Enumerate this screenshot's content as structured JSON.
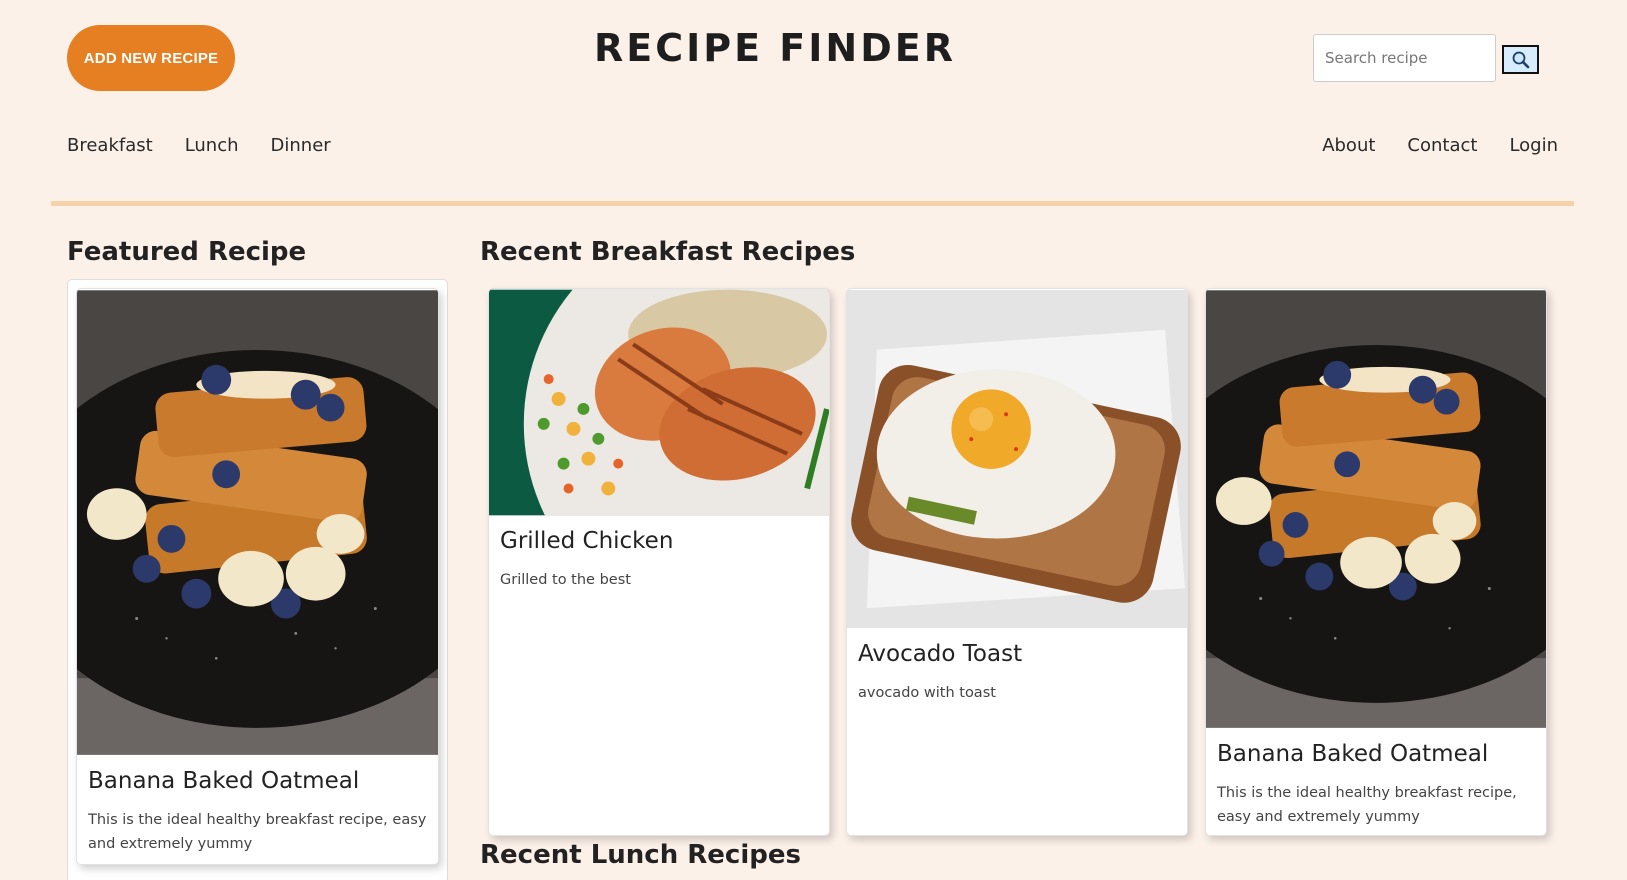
{
  "header": {
    "add_button": "ADD NEW RECIPE",
    "title": "RECIPE FINDER",
    "search_placeholder": "Search recipe",
    "search_icon": "magnifier-icon"
  },
  "nav": {
    "left": [
      "Breakfast",
      "Lunch",
      "Dinner"
    ],
    "right": [
      "About",
      "Contact",
      "Login"
    ]
  },
  "featured": {
    "heading": "Featured Recipe",
    "title": "Banana Baked Oatmeal",
    "desc": "This is the ideal healthy breakfast recipe, easy and extremely yummy"
  },
  "breakfast": {
    "heading": "Recent Breakfast Recipes",
    "cards": [
      {
        "title": "Grilled Chicken",
        "desc": "Grilled to the best"
      },
      {
        "title": "Avocado Toast",
        "desc": "avocado with toast"
      },
      {
        "title": "Banana Baked Oatmeal",
        "desc": "This is the ideal healthy breakfast recipe, easy and extremely yummy"
      }
    ]
  },
  "lunch": {
    "heading": "Recent Lunch Recipes"
  },
  "colors": {
    "background": "#fcf1e9",
    "accent": "#e67e22",
    "divider": "#f5d2a8"
  }
}
